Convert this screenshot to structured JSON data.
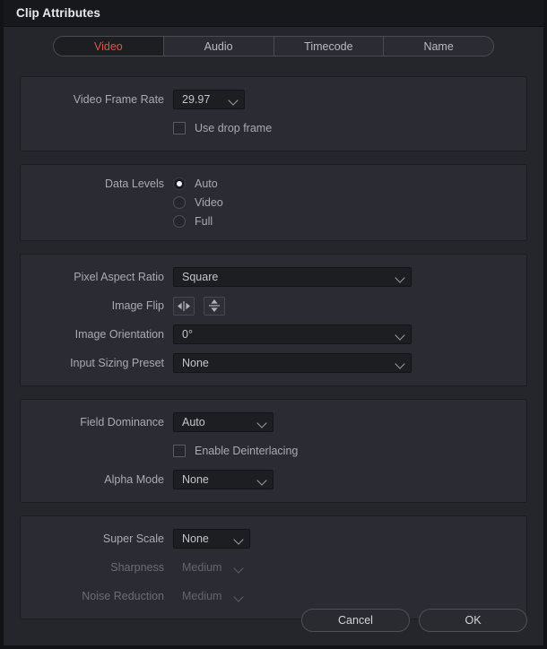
{
  "window": {
    "title": "Clip Attributes"
  },
  "tabs": [
    {
      "label": "Video",
      "active": true
    },
    {
      "label": "Audio",
      "active": false
    },
    {
      "label": "Timecode",
      "active": false
    },
    {
      "label": "Name",
      "active": false
    }
  ],
  "sections": {
    "frame_rate": {
      "video_frame_rate_label": "Video Frame Rate",
      "video_frame_rate_value": "29.97",
      "use_drop_frame_label": "Use drop frame",
      "use_drop_frame_checked": false
    },
    "data_levels": {
      "label": "Data Levels",
      "options": [
        {
          "label": "Auto",
          "selected": true
        },
        {
          "label": "Video",
          "selected": false
        },
        {
          "label": "Full",
          "selected": false
        }
      ]
    },
    "image": {
      "pixel_aspect_ratio_label": "Pixel Aspect Ratio",
      "pixel_aspect_ratio_value": "Square",
      "image_flip_label": "Image Flip",
      "flip_horizontal_icon": "flip-horizontal-icon",
      "flip_vertical_icon": "flip-vertical-icon",
      "image_orientation_label": "Image Orientation",
      "image_orientation_value": "0°",
      "input_sizing_preset_label": "Input Sizing Preset",
      "input_sizing_preset_value": "None"
    },
    "field": {
      "field_dominance_label": "Field Dominance",
      "field_dominance_value": "Auto",
      "enable_deinterlacing_label": "Enable Deinterlacing",
      "enable_deinterlacing_checked": false,
      "alpha_mode_label": "Alpha Mode",
      "alpha_mode_value": "None"
    },
    "super_scale": {
      "super_scale_label": "Super Scale",
      "super_scale_value": "None",
      "sharpness_label": "Sharpness",
      "sharpness_value": "Medium",
      "sharpness_disabled": true,
      "noise_reduction_label": "Noise Reduction",
      "noise_reduction_value": "Medium",
      "noise_reduction_disabled": true
    }
  },
  "footer": {
    "cancel_label": "Cancel",
    "ok_label": "OK"
  },
  "colors": {
    "accent_active_tab_text": "#d8564a",
    "window_background": "#25262c",
    "panel_background": "#2b2c33",
    "titlebar_background": "#17181c",
    "field_background": "#1d1e22",
    "text_primary": "#c3c5ca",
    "text_label": "#a9abb1",
    "text_disabled": "#64666d"
  }
}
